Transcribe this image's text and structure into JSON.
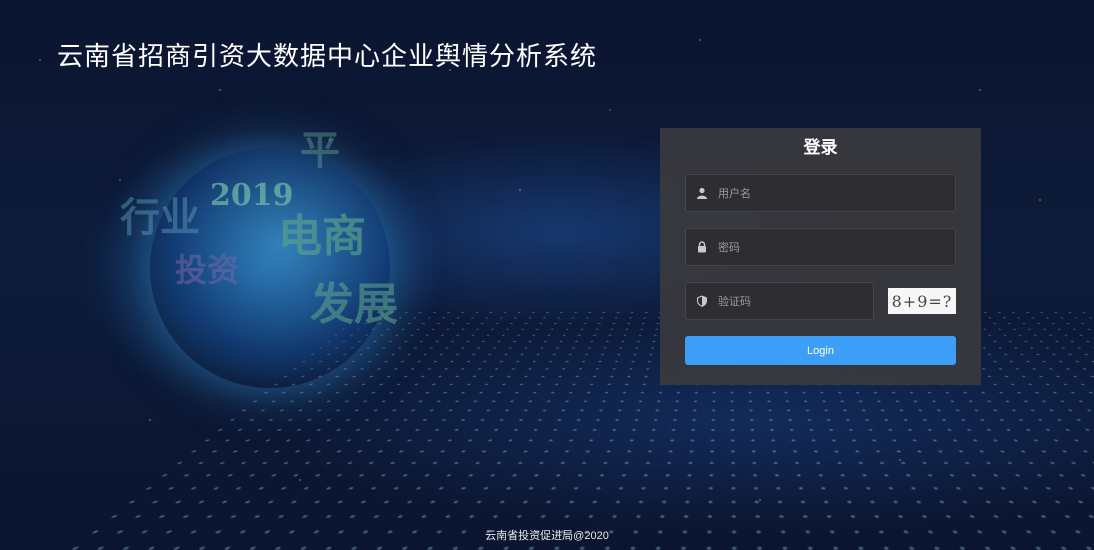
{
  "header": {
    "title": "云南省招商引资大数据中心企业舆情分析系统"
  },
  "background_words": [
    "电商",
    "发展",
    "2019",
    "行业",
    "投资",
    "平"
  ],
  "login": {
    "title": "登录",
    "username": {
      "placeholder": "用户名",
      "icon": "user-icon"
    },
    "password": {
      "placeholder": "密码",
      "icon": "lock-icon"
    },
    "captcha": {
      "placeholder": "验证码",
      "icon": "shield-icon",
      "image_text": "8+9=?"
    },
    "submit_label": "Login",
    "colors": {
      "panel": "#3a3a3e",
      "button": "#3d9ef8"
    }
  },
  "footer": {
    "text": "云南省投资促进局@2020"
  }
}
